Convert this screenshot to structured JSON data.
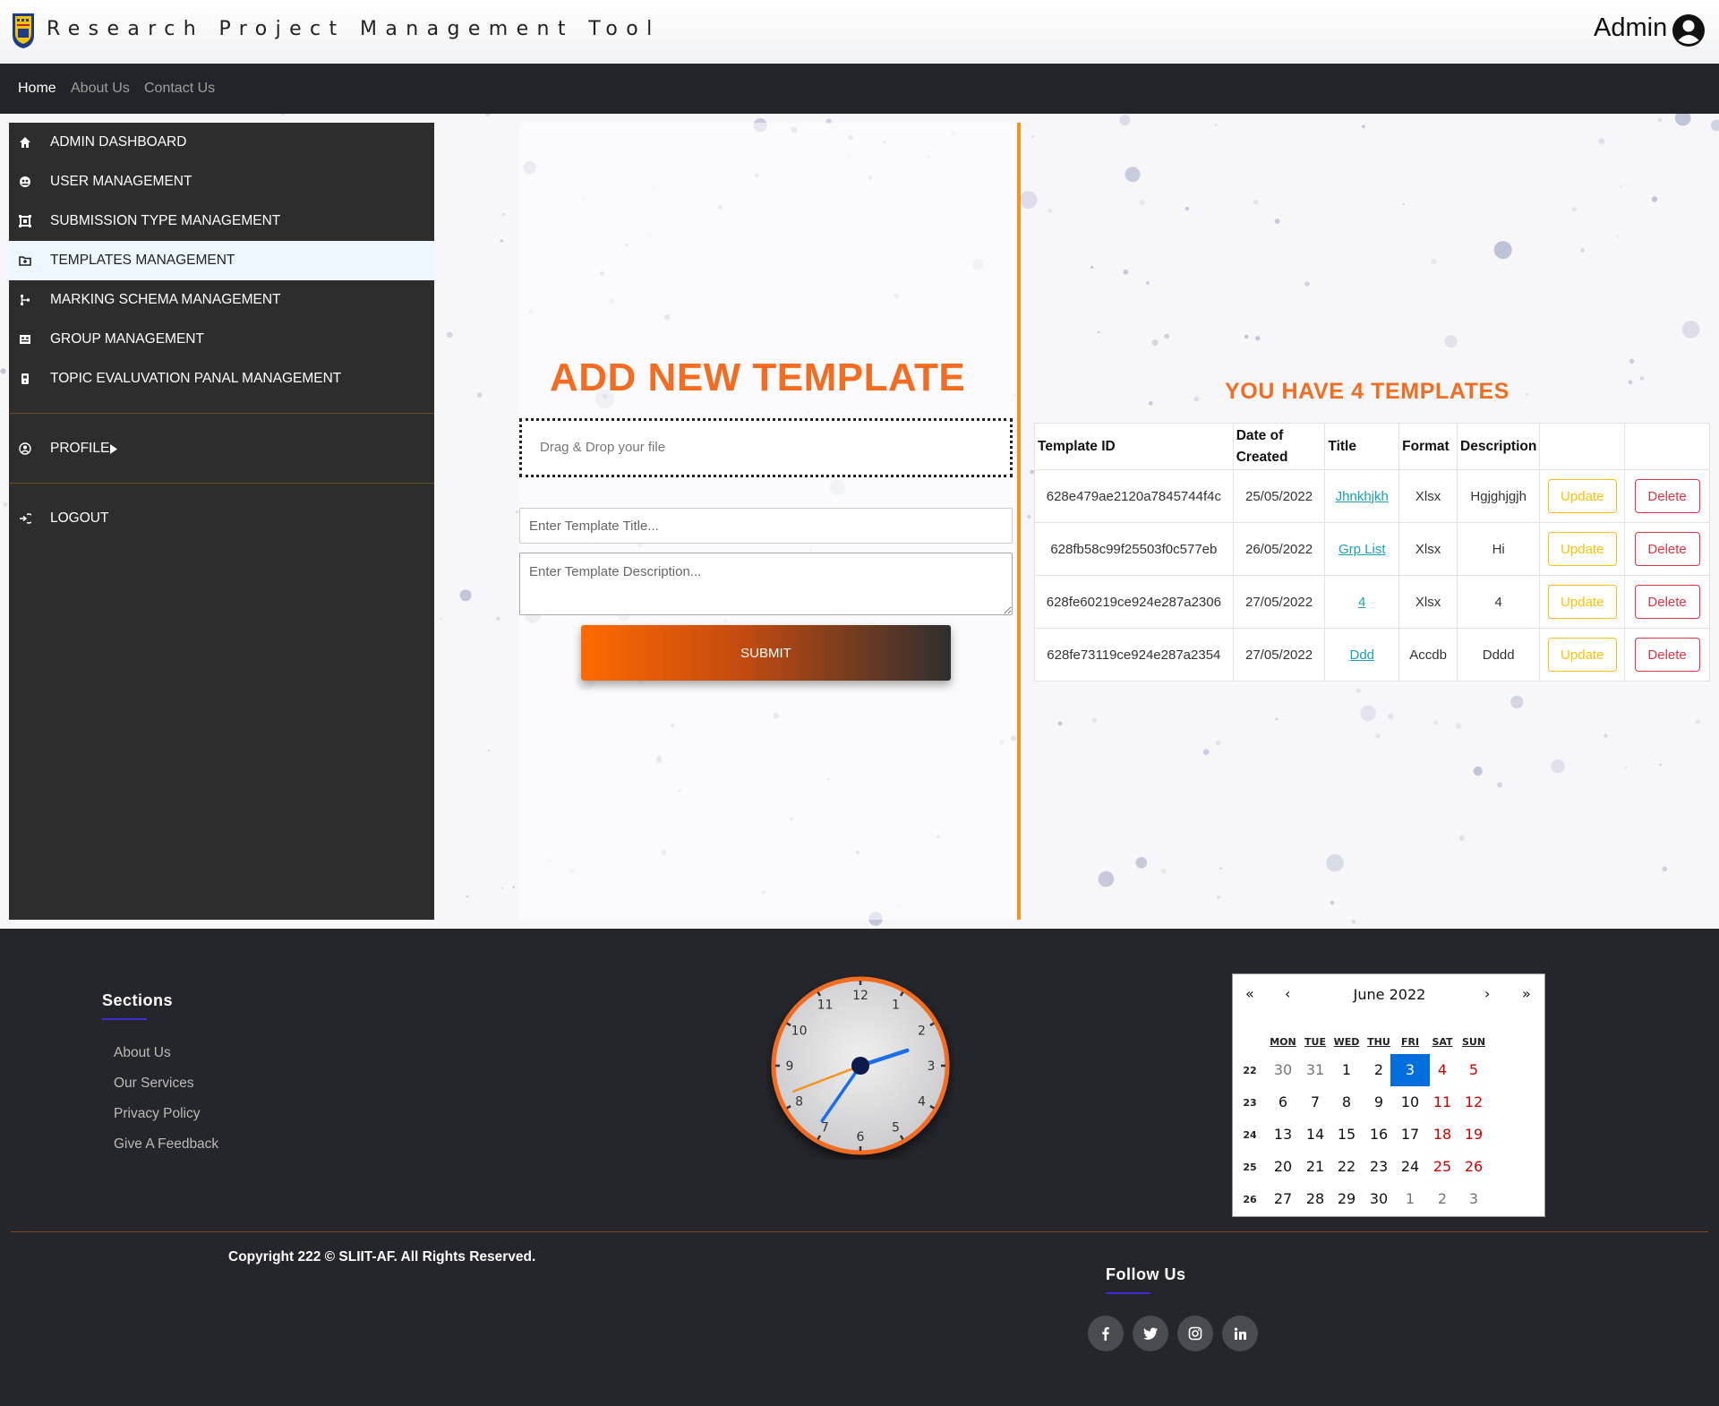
{
  "header": {
    "app_title": "Research Project Management Tool",
    "user_name": "Admin"
  },
  "navbar": {
    "links": [
      {
        "label": "Home",
        "active": true
      },
      {
        "label": "About Us",
        "active": false
      },
      {
        "label": "Contact Us",
        "active": false
      }
    ]
  },
  "sidebar": {
    "items": [
      {
        "label": "ADMIN DASHBOARD",
        "icon": "home-icon"
      },
      {
        "label": "USER MANAGEMENT",
        "icon": "users-icon"
      },
      {
        "label": "SUBMISSION TYPE MANAGEMENT",
        "icon": "submission-icon"
      },
      {
        "label": "TEMPLATES MANAGEMENT",
        "icon": "folder-icon",
        "active": true
      },
      {
        "label": "MARKING SCHEMA MANAGEMENT",
        "icon": "schema-icon"
      },
      {
        "label": "GROUP MANAGEMENT",
        "icon": "group-icon"
      },
      {
        "label": "TOPIC EVALUVATION PANAL MANAGEMENT",
        "icon": "panel-icon"
      }
    ],
    "profile_label": "PROFILE",
    "logout_label": "LOGOUT"
  },
  "form": {
    "title": "ADD NEW TEMPLATE",
    "dropzone_text": "Drag & Drop your file",
    "title_placeholder": "Enter Template Title...",
    "description_placeholder": "Enter Template Description...",
    "submit_label": "SUBMIT"
  },
  "templates": {
    "heading": "YOU HAVE 4 TEMPLATES",
    "columns": [
      "Template ID",
      "Date of Created",
      "Title",
      "Format",
      "Description",
      "",
      ""
    ],
    "update_label": "Update",
    "delete_label": "Delete",
    "rows": [
      {
        "id": "628e479ae2120a7845744f4c",
        "date": "25/05/2022",
        "title": "Jhnkhjkh",
        "format": "Xlsx",
        "description": "Hgjghjgjh"
      },
      {
        "id": "628fb58c99f25503f0c577eb",
        "date": "26/05/2022",
        "title": "Grp List",
        "format": "Xlsx",
        "description": "Hi"
      },
      {
        "id": "628fe60219ce924e287a2306",
        "date": "27/05/2022",
        "title": "4",
        "format": "Xlsx",
        "description": "4"
      },
      {
        "id": "628fe73119ce924e287a2354",
        "date": "27/05/2022",
        "title": "Ddd",
        "format": "Accdb",
        "description": "Dddd"
      }
    ]
  },
  "footer": {
    "sections_heading": "Sections",
    "links": [
      "About Us",
      "Our Services",
      "Privacy Policy",
      "Give A Feedback"
    ],
    "copyright": "Copyright 222 © SLIIT-AF. All Rights Reserved.",
    "follow_heading": "Follow Us",
    "social": [
      "facebook-icon",
      "twitter-icon",
      "instagram-icon",
      "linkedin-icon"
    ]
  },
  "clock": {
    "time_hours": 2.4,
    "time_minutes": 35.8,
    "time_seconds": 41.5,
    "numbers": [
      "12",
      "1",
      "2",
      "3",
      "4",
      "5",
      "6",
      "7",
      "8",
      "9",
      "10",
      "11"
    ]
  },
  "calendar": {
    "nav_first": "«",
    "nav_prev": "‹",
    "nav_next": "›",
    "nav_last": "»",
    "month_label": "June 2022",
    "weekdays": [
      "MON",
      "TUE",
      "WED",
      "THU",
      "FRI",
      "SAT",
      "SUN"
    ],
    "weeks": [
      {
        "num": "22",
        "days": [
          "30",
          "31",
          "1",
          "2",
          "3",
          "4",
          "5"
        ]
      },
      {
        "num": "23",
        "days": [
          "6",
          "7",
          "8",
          "9",
          "10",
          "11",
          "12"
        ]
      },
      {
        "num": "24",
        "days": [
          "13",
          "14",
          "15",
          "16",
          "17",
          "18",
          "19"
        ]
      },
      {
        "num": "25",
        "days": [
          "20",
          "21",
          "22",
          "23",
          "24",
          "25",
          "26"
        ]
      },
      {
        "num": "26",
        "days": [
          "27",
          "28",
          "29",
          "30",
          "1",
          "2",
          "3"
        ]
      }
    ],
    "today": "3"
  },
  "colors": {
    "accent_orange": "#f26d21",
    "nav_dark": "#212529",
    "sidebar_dark": "#2d2d2d",
    "footer_dark": "#24262b",
    "calendar_today": "#006edc"
  }
}
